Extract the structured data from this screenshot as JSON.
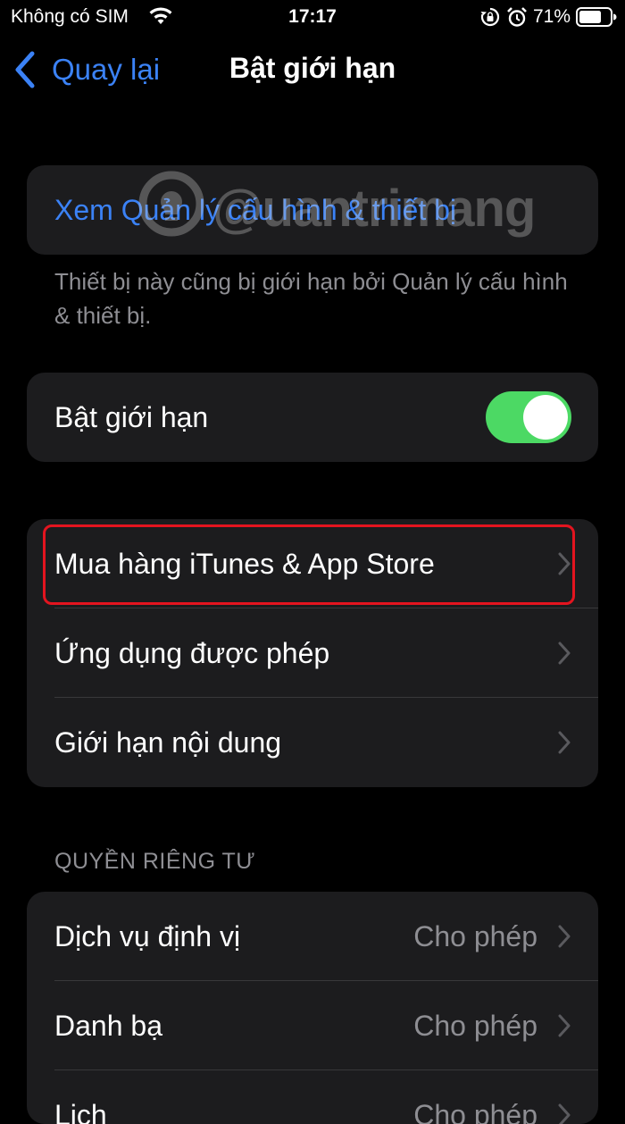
{
  "status_bar": {
    "carrier": "Không có SIM",
    "time": "17:17",
    "battery": "71%"
  },
  "nav": {
    "back_label": "Quay lại",
    "title": "Bật giới hạn"
  },
  "profile_group": {
    "link_label": "Xem Quản lý cấu hình & thiết bị",
    "footer": "Thiết bị này cũng bị giới hạn bởi Quản lý cấu hình & thiết bị."
  },
  "restrictions_toggle": {
    "label": "Bật giới hạn",
    "on": true
  },
  "main_group": {
    "items": [
      {
        "label": "Mua hàng iTunes & App Store"
      },
      {
        "label": "Ứng dụng được phép"
      },
      {
        "label": "Giới hạn nội dung"
      }
    ]
  },
  "privacy_section": {
    "header": "QUYỀN RIÊNG TƯ",
    "items": [
      {
        "label": "Dịch vụ định vị",
        "value": "Cho phép"
      },
      {
        "label": "Danh bạ",
        "value": "Cho phép"
      },
      {
        "label": "Lịch",
        "value": "Cho phép"
      }
    ]
  },
  "watermark": "@uantrimang",
  "colors": {
    "accent": "#3b82f6",
    "toggle_on": "#4cd964",
    "highlight": "#e3141f"
  }
}
